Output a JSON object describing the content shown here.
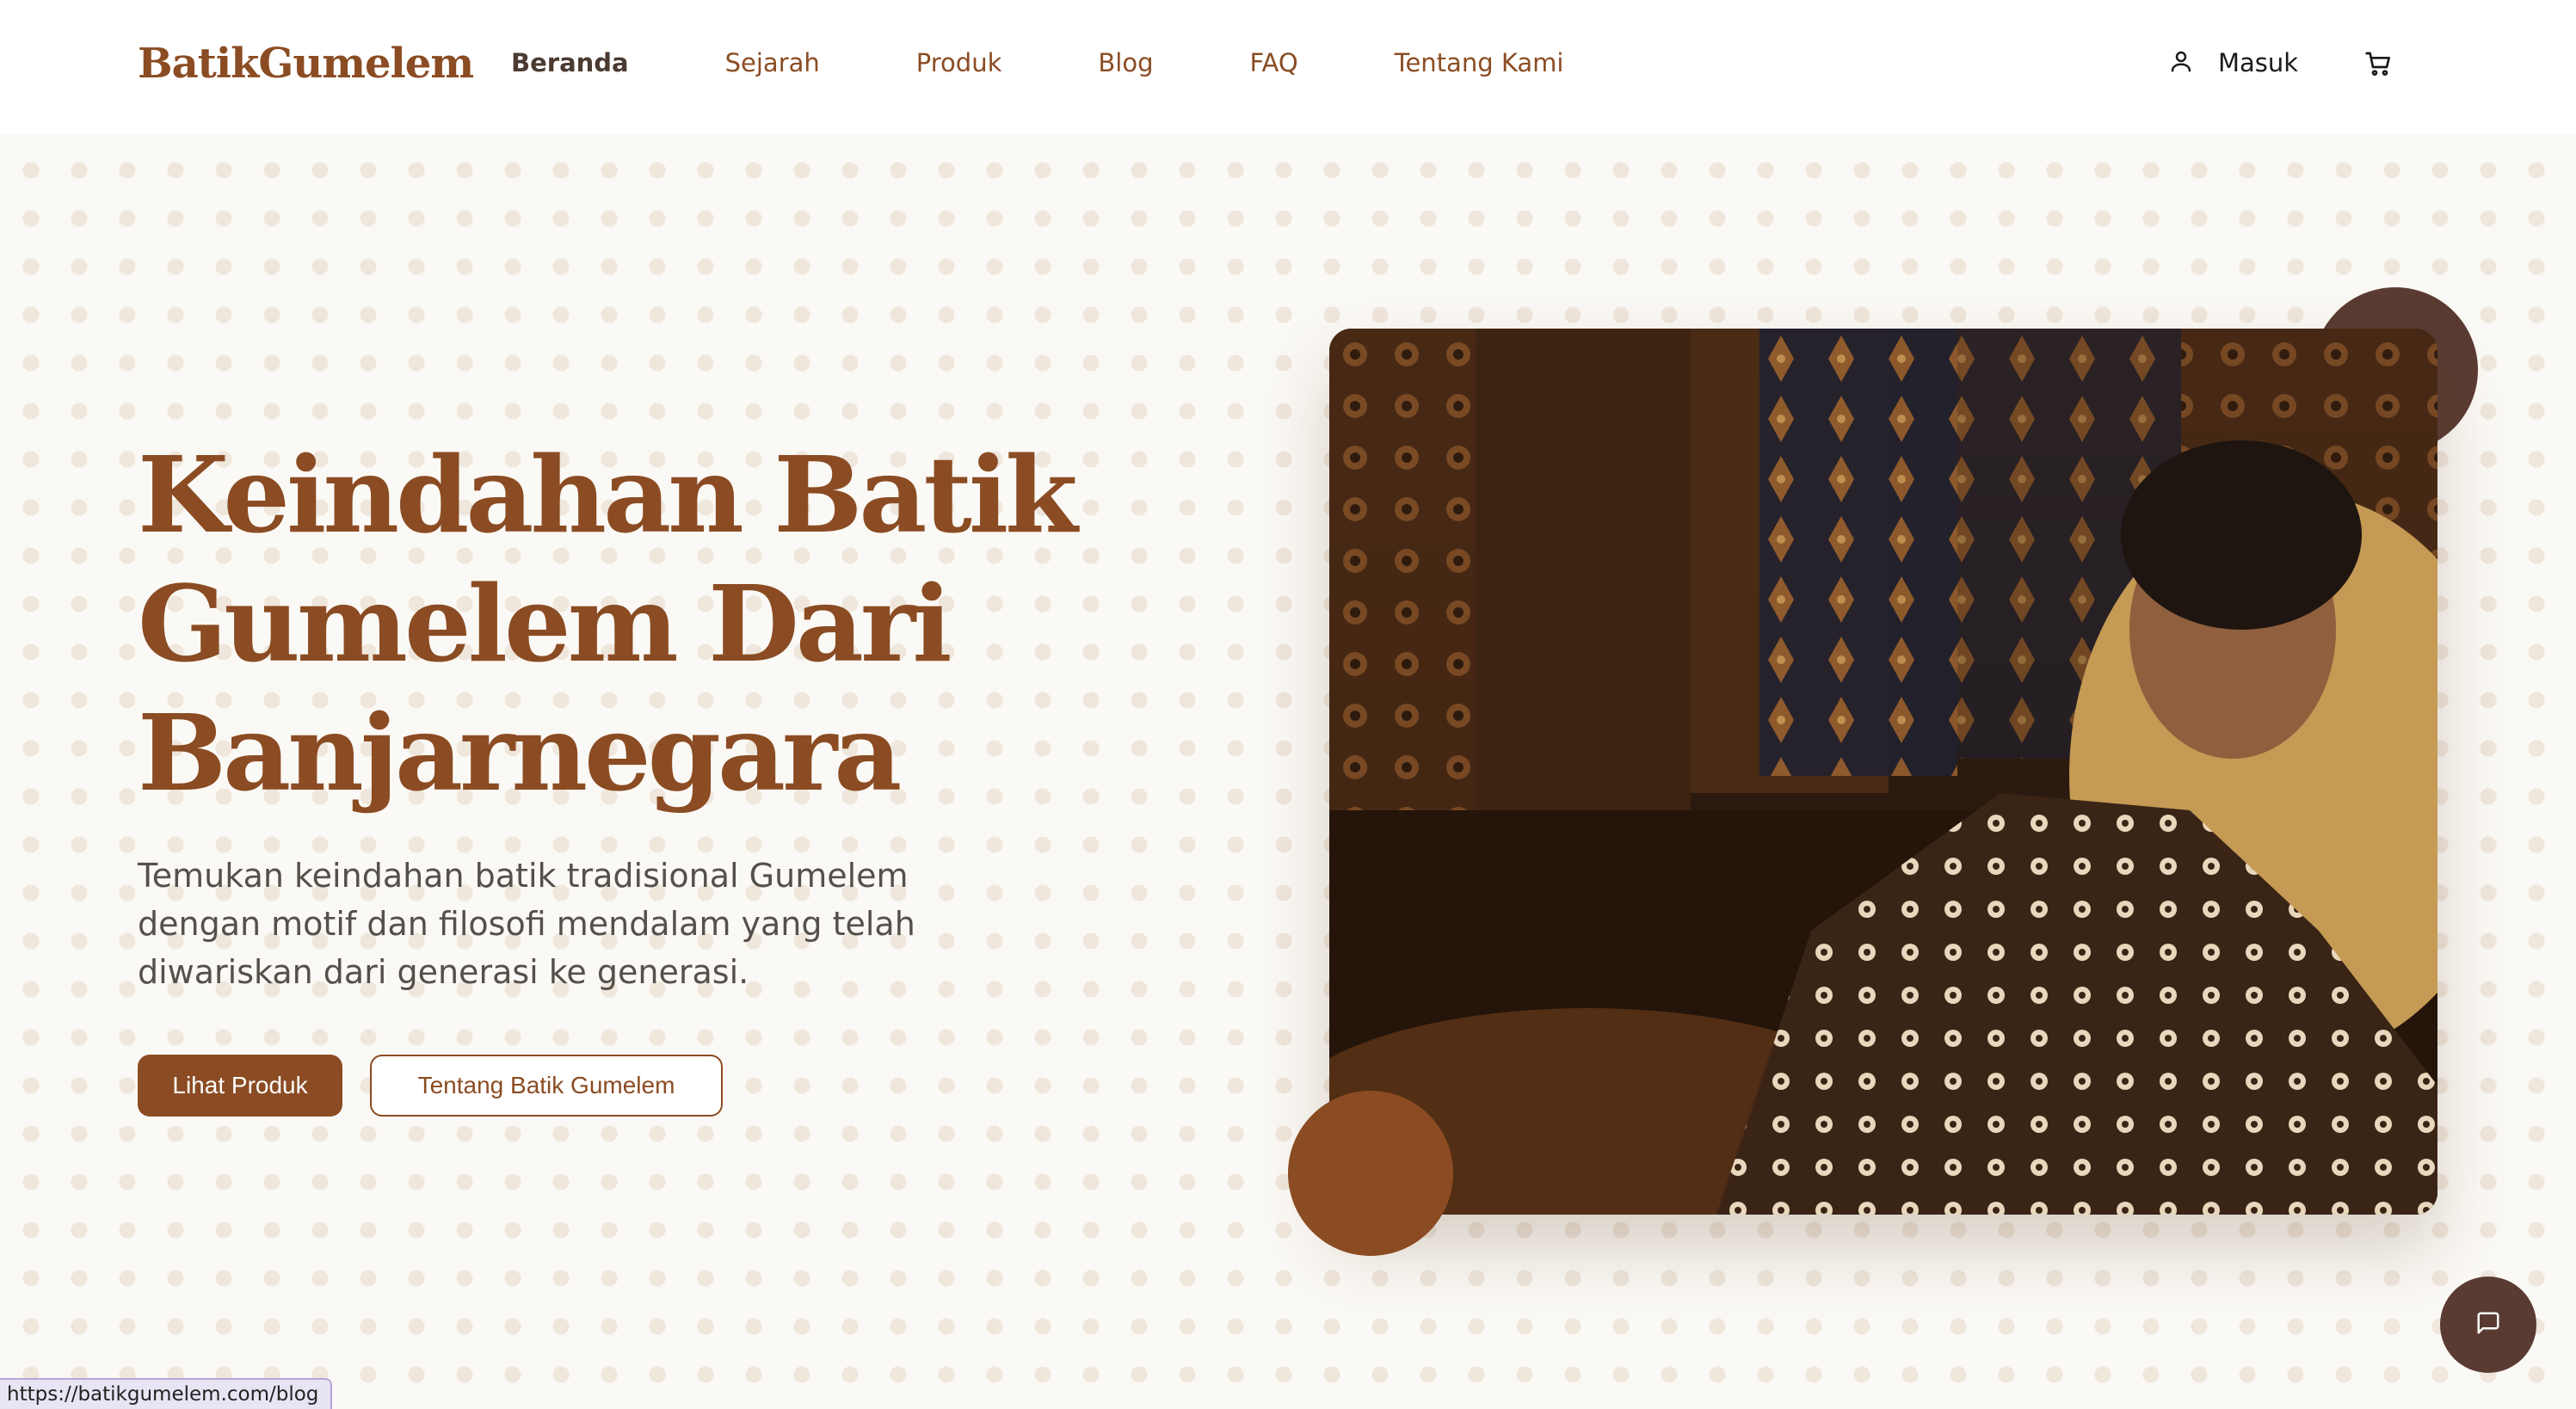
{
  "header": {
    "logo": "BatikGumelem",
    "nav": [
      {
        "label": "Beranda",
        "active": true
      },
      {
        "label": "Sejarah",
        "active": false
      },
      {
        "label": "Produk",
        "active": false
      },
      {
        "label": "Blog",
        "active": false
      },
      {
        "label": "FAQ",
        "active": false
      },
      {
        "label": "Tentang Kami",
        "active": false
      }
    ],
    "login_label": "Masuk",
    "login_icon": "user-icon",
    "cart_icon": "cart-icon"
  },
  "hero": {
    "title": "Keindahan Batik Gumelem Dari Banjarnegara",
    "subtitle": "Temukan keindahan batik tradisional Gumelem dengan motif dan filosofi mendalam yang telah diwariskan dari generasi ke generasi.",
    "primary_button": "Lihat Produk",
    "secondary_button": "Tentang Batik Gumelem"
  },
  "chat": {
    "icon": "chat-icon"
  },
  "status_bar": {
    "url": "https://batikgumelem.com/blog"
  },
  "colors": {
    "brand": "#8b4c23",
    "accent_dark": "#5a3b32",
    "background": "#fbf9f5"
  }
}
